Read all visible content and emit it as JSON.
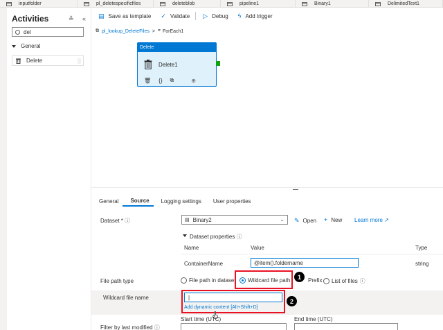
{
  "tabs": [
    {
      "label": "inputfolder"
    },
    {
      "label": "pl_deletespecificfiles"
    },
    {
      "label": "deleteblob"
    },
    {
      "label": "pipeline1"
    },
    {
      "label": "Binary1"
    },
    {
      "label": "DelimitedText1"
    }
  ],
  "sidebar": {
    "title": "Activities",
    "controls": "≚ «",
    "search_value": "del",
    "group_label": "General",
    "item_label": "Delete"
  },
  "toolbar": {
    "save_template": "Save as template",
    "validate": "Validate",
    "debug": "Debug",
    "add_trigger": "Add trigger"
  },
  "breadcrumb": {
    "pipeline": "pl_lookup_DeleteFiles",
    "separator": ">",
    "activity": "ForEach1"
  },
  "node": {
    "header": "Delete",
    "name": "Delete1"
  },
  "property_tabs": [
    {
      "label": "General"
    },
    {
      "label": "Source"
    },
    {
      "label": "Logging settings"
    },
    {
      "label": "User properties"
    }
  ],
  "source": {
    "dataset_label": "Dataset *",
    "dataset_value": "Binary2",
    "open_label": "Open",
    "new_label": "New",
    "learn_more": "Learn more",
    "dataset_properties_label": "Dataset properties",
    "col_name": "Name",
    "col_value": "Value",
    "col_type": "Type",
    "row_name": "ContainerName",
    "row_value": "@item().foldername",
    "row_type": "string",
    "file_path_type_label": "File path type",
    "opt_file_path_in_dataset": "File path in dataset",
    "opt_wildcard_file_path": "Wildcard file path",
    "opt_prefix": "Prefix",
    "opt_list_of_files": "List of files",
    "selected_option": "Wildcard file path",
    "wildcard_file_name_label": "Wildcard file name",
    "wildcard_value": "",
    "dynamic_content_hint": "Add dynamic content [Alt+Shift+D]",
    "filter_label": "Filter by last modified",
    "start_time_label": "Start time (UTC)",
    "end_time_label": "End time (UTC)"
  },
  "callouts": {
    "badge_1": "1",
    "badge_2": "2"
  },
  "colors": {
    "accent": "#0078d4",
    "highlight": "#e81123",
    "node_fill": "#dff1fb",
    "port": "#13a10e"
  }
}
